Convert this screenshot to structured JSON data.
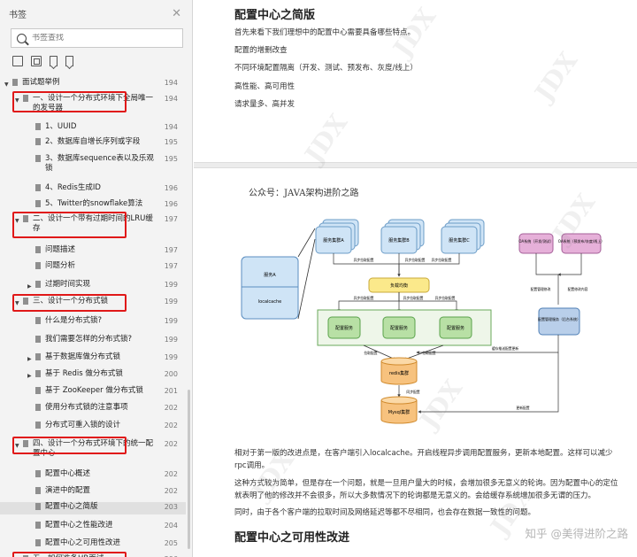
{
  "sidebar": {
    "title": "书签",
    "close_glyph": "✕",
    "search_placeholder": "书签查找",
    "toolbar_icons": [
      "expand-all-icon",
      "collapse-all-icon",
      "bookmark-add-icon",
      "bookmark-icon"
    ],
    "items": [
      {
        "label": "面试题举例",
        "page": "194",
        "level": 0,
        "expanded": true
      },
      {
        "label": "一、设计一个分布式环境下全局唯一的发号器",
        "page": "194",
        "level": 1,
        "expanded": true,
        "highlighted": true
      },
      {
        "label": "1、UUID",
        "page": "194",
        "level": 2
      },
      {
        "label": "2、数据库自增长序列或字段",
        "page": "195",
        "level": 2
      },
      {
        "label": "3、数据库sequence表以及乐观锁",
        "page": "195",
        "level": 2
      },
      {
        "label": "4、Redis生成ID",
        "page": "196",
        "level": 2
      },
      {
        "label": "5、Twitter的snowflake算法",
        "page": "196",
        "level": 2
      },
      {
        "label": "二、设计一个带有过期时间的LRU缓存",
        "page": "197",
        "level": 1,
        "expanded": true,
        "highlighted": true
      },
      {
        "label": "问题描述",
        "page": "197",
        "level": 2
      },
      {
        "label": "问题分析",
        "page": "197",
        "level": 2
      },
      {
        "label": "过期时间实现",
        "page": "199",
        "level": 2,
        "collapsed": true
      },
      {
        "label": "三、设计一个分布式锁",
        "page": "199",
        "level": 1,
        "expanded": true,
        "highlighted": true
      },
      {
        "label": "什么是分布式锁?",
        "page": "199",
        "level": 2
      },
      {
        "label": "我们需要怎样的分布式锁?",
        "page": "199",
        "level": 2
      },
      {
        "label": "基于数据库做分布式锁",
        "page": "199",
        "level": 2,
        "collapsed": true
      },
      {
        "label": "基于 Redis 做分布式锁",
        "page": "200",
        "level": 2,
        "collapsed": true
      },
      {
        "label": "基于 ZooKeeper 做分布式锁",
        "page": "201",
        "level": 2
      },
      {
        "label": "使用分布式锁的注意事项",
        "page": "202",
        "level": 2
      },
      {
        "label": "分布式可重入锁的设计",
        "page": "202",
        "level": 2
      },
      {
        "label": "四、设计一个分布式环境下的统一配置中心",
        "page": "202",
        "level": 1,
        "expanded": true,
        "highlighted": true
      },
      {
        "label": "配置中心概述",
        "page": "202",
        "level": 2
      },
      {
        "label": "演进中的配置",
        "page": "202",
        "level": 2
      },
      {
        "label": "配置中心之简版",
        "page": "203",
        "level": 2,
        "selected": true
      },
      {
        "label": "配置中心之性能改进",
        "page": "204",
        "level": 2
      },
      {
        "label": "配置中心之可用性改进",
        "page": "205",
        "level": 2
      },
      {
        "label": "五、如何准备HR面试",
        "page": "206",
        "level": 1,
        "highlighted": true
      }
    ]
  },
  "document": {
    "page1": {
      "heading": "配置中心之简版",
      "paragraphs": [
        "首先来看下我们理想中的配置中心需要具备哪些特点。",
        "配置的增删改查",
        "不同环境配置隔离（开发、测试、预发布、灰度/线上）",
        "高性能、高可用性",
        "请求量多、高并发"
      ]
    },
    "page2": {
      "caption": "公众号：JAVA架构进阶之路",
      "diagram": {
        "clients": [
          "服务集群A",
          "服务集群B",
          "服务集群C"
        ],
        "client_app": "服务A",
        "local_cache": "localcache",
        "load_balancer": "负载均衡",
        "config_services": [
          "配置服务",
          "配置服务",
          "配置服务"
        ],
        "admin_systems": [
          "OA系统（开发/测试）",
          "OA系统（预发布/灰度/线上）"
        ],
        "config_admin": "配置管理服务（后台系统）",
        "redis": "redis集群",
        "mysql": "Mysql集群",
        "edge_labels": {
          "async_fetch": "异步拉取配置",
          "pull": "拉取配置",
          "save": "保存配置",
          "update": "更新配置",
          "cache": "缓存推送配置更新",
          "sync": "同步配置",
          "modify": "配置管理修改",
          "change": "配置修改内容"
        }
      },
      "paragraphs": [
        "相对于第一版的改进点是，在客户端引入localcache。开启线程异步调用配置服务，更新本地配置。这样可以减少rpc调用。",
        "这种方式较为简单，但是存在一个问题，就是一旦用户量大的时候，会增加很多无意义的轮询。因为配置中心的定位就表明了他的修改并不会很多，所以大多数情况下的轮询都是无意义的。会给缓存系统增加很多无谓的压力。",
        "同时，由于各个客户端的拉取时间及网络延迟等都不尽相同，也会存在数据一致性的问题。"
      ],
      "next_heading": "配置中心之可用性改进"
    },
    "watermark": "JDX",
    "zhihu_mark": "知乎 @美得进阶之路"
  },
  "colors": {
    "highlight_box": "#e01818",
    "client_fill": "#cfe4f6",
    "client_stroke": "#6b9cc7",
    "lb_fill": "#fbe98b",
    "service_fill": "#b8e0a5",
    "service_stroke": "#5aa24c",
    "admin_fill": "#e6b0d9",
    "db_fill": "#f7c27e"
  }
}
